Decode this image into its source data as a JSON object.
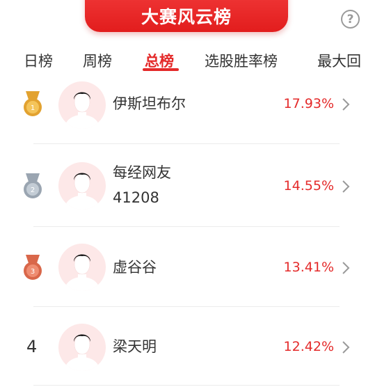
{
  "header": {
    "banner_title": "大赛风云榜",
    "help_icon": "question-circle-icon"
  },
  "tabs": [
    {
      "label": "日榜",
      "active": false
    },
    {
      "label": "周榜",
      "active": false
    },
    {
      "label": "总榜",
      "active": true
    },
    {
      "label": "选股胜率榜",
      "active": false
    },
    {
      "label": "最大回"
    }
  ],
  "rankings": [
    {
      "rank": "1",
      "medal": "gold-medal-icon",
      "name": "伊斯坦布尔",
      "name_line2": "",
      "return_pct": "17.93%"
    },
    {
      "rank": "2",
      "medal": "silver-medal-icon",
      "name": "每经网友",
      "name_line2": "41208",
      "return_pct": "14.55%"
    },
    {
      "rank": "3",
      "medal": "bronze-medal-icon",
      "name": "虚谷谷",
      "name_line2": "",
      "return_pct": "13.41%"
    },
    {
      "rank": "4",
      "medal": "",
      "name": "梁天明",
      "name_line2": "",
      "return_pct": "12.42%"
    }
  ],
  "colors": {
    "accent": "#e42a2a",
    "gold": "#e2a230",
    "silver": "#9aa5b1",
    "bronze": "#d9674a"
  }
}
